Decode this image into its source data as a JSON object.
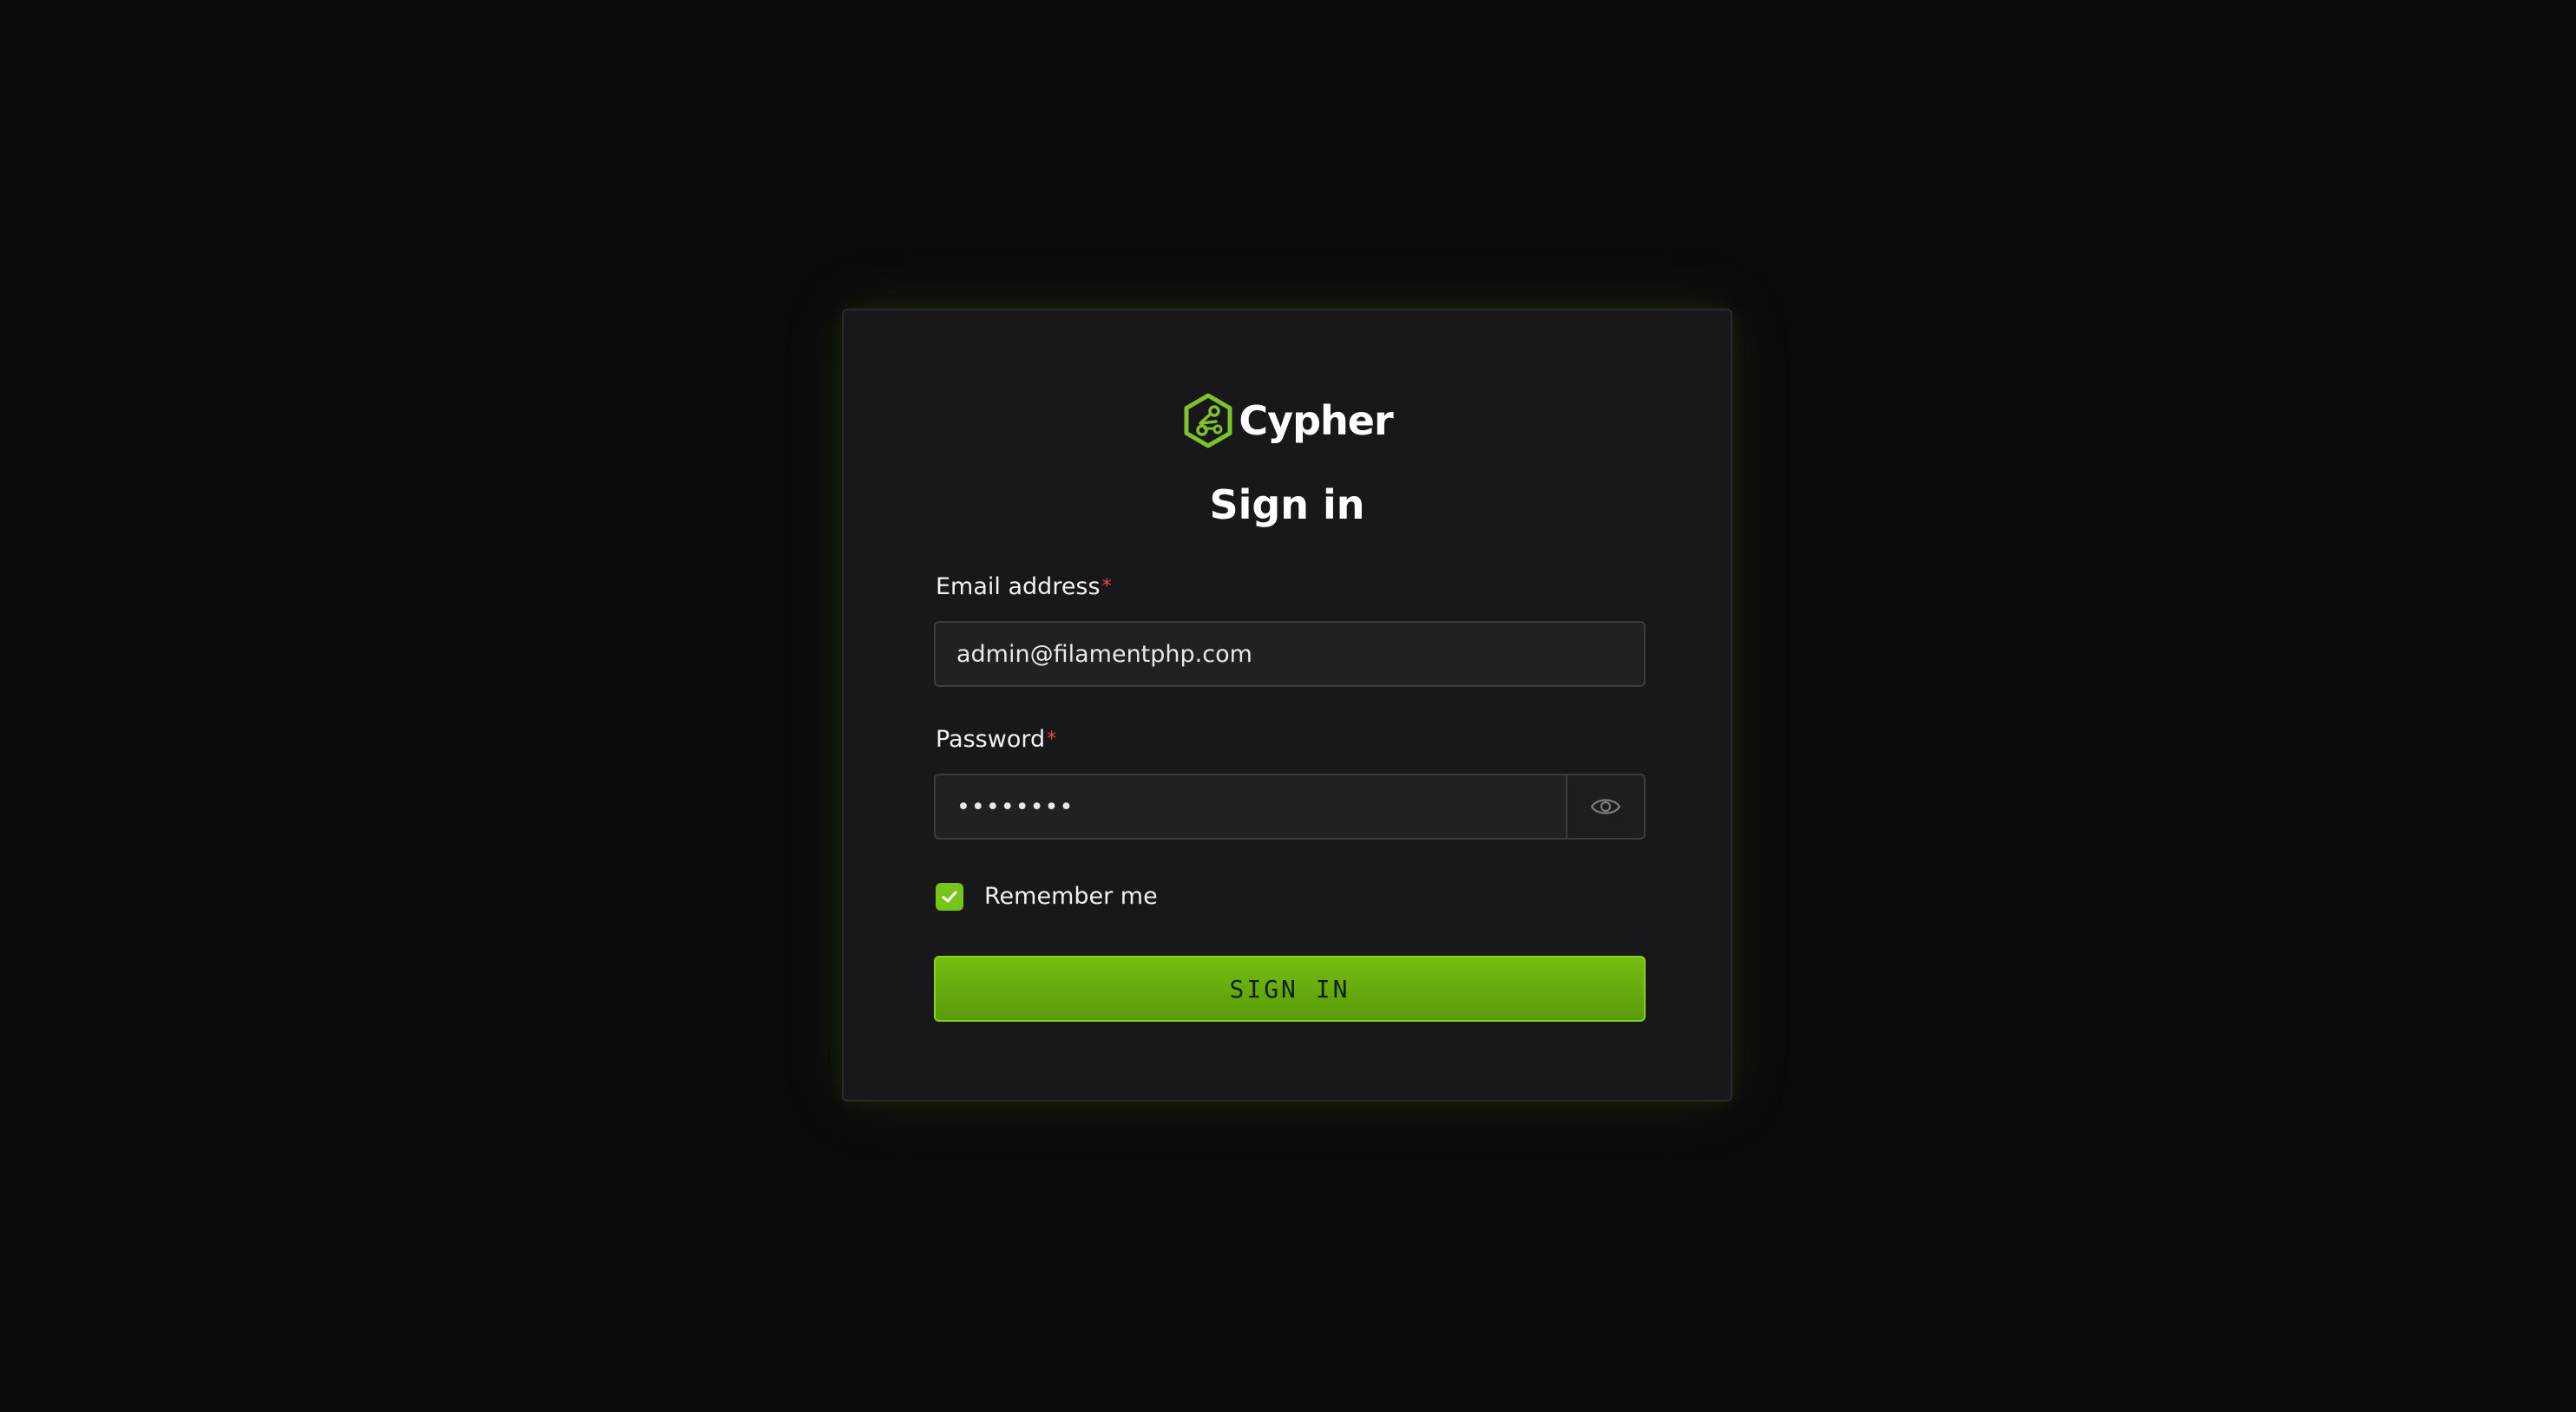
{
  "brand": {
    "name": "Cypher",
    "logo_icon": "hexagon-circuit-logo",
    "accent_color": "#76c51a"
  },
  "form": {
    "title": "Sign in",
    "email": {
      "label": "Email address",
      "required_mark": "*",
      "value": "admin@filamentphp.com"
    },
    "password": {
      "label": "Password",
      "required_mark": "*",
      "value": "password",
      "toggle_icon": "eye-icon"
    },
    "remember": {
      "label": "Remember me",
      "checked": true
    },
    "submit_label": "SIGN IN"
  }
}
